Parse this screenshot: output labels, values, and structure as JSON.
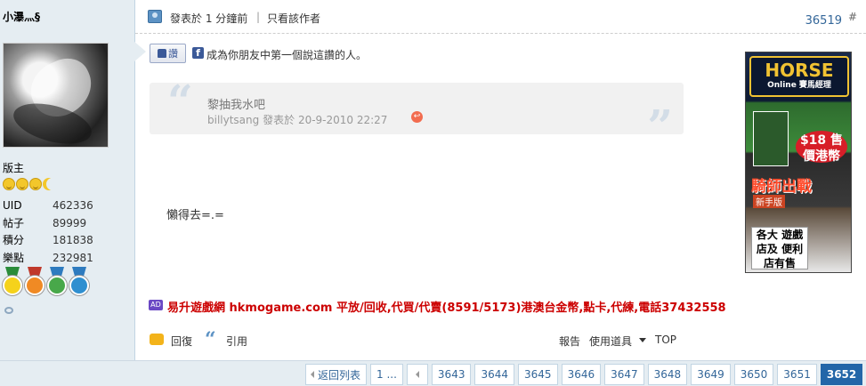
{
  "user": {
    "name": "小瀑灬§",
    "role": "版主",
    "stats": [
      {
        "key": "UID",
        "value": "462336"
      },
      {
        "key": "帖子",
        "value": "89999"
      },
      {
        "key": "積分",
        "value": "181838"
      },
      {
        "key": "樂點",
        "value": "232981"
      }
    ],
    "medals": [
      {
        "icon": "medal-5-icon",
        "ribbon": "#2a8c3a",
        "color": "#f5d21b"
      },
      {
        "icon": "medal-orange-icon",
        "ribbon": "#c0392b",
        "color": "#f08a24"
      },
      {
        "icon": "medal-green-icon",
        "ribbon": "#2e7bbf",
        "color": "#48a84a"
      },
      {
        "icon": "medal-blue-icon",
        "ribbon": "#2e7bbf",
        "color": "#2f8fd0"
      }
    ]
  },
  "post": {
    "posted_label": "發表於",
    "posted_time": "1 分鐘前",
    "separator": "|",
    "only_author": "只看該作者",
    "post_number": "36519",
    "hash": "#",
    "like_button": "讚",
    "facebook_glyph": "f",
    "like_prompt": "成為你朋友中第一個說這讚的人。",
    "quote": {
      "text": "黎抽我水吧",
      "author": "billytsang",
      "posted_label": "發表於",
      "date": "20-9-2010 22:27"
    },
    "content": "懶得去=.=",
    "sponsor": {
      "tag": "AD",
      "text": "易升遊戲網 hkmogame.com 平放/回收,代買/代賣(8591/5173)港澳台金幣,點卡,代練,電話37432558"
    }
  },
  "banner": {
    "logo_top": "HORSE",
    "logo_sub": "Online 賽馬經理",
    "price": "$18 售價港幣",
    "title": "騎師出戰",
    "subtitle": "新手版",
    "shops": "各大 遊戲店及 便利店有售"
  },
  "actions": {
    "reply": "回復",
    "quote": "引用",
    "report": "報告",
    "tools": "使用道具",
    "top": "TOP"
  },
  "pagination": {
    "back": "返回列表",
    "first": "1 ...",
    "pages": [
      "3643",
      "3644",
      "3645",
      "3646",
      "3647",
      "3648",
      "3649",
      "3650",
      "3651"
    ],
    "current": "3652"
  },
  "colors": {
    "panel": "#e5edf2",
    "link": "#336699",
    "current_page": "#2366a8",
    "sponsor": "#cc0000"
  }
}
